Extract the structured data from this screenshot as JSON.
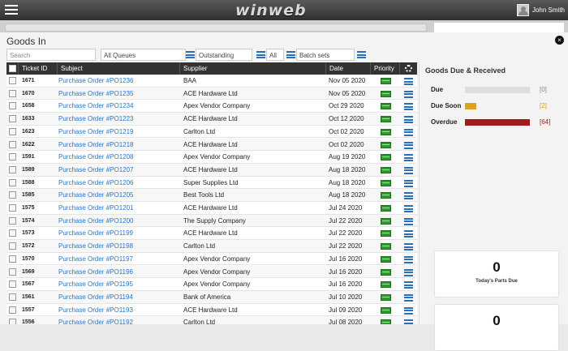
{
  "app": {
    "logo": "winweb",
    "user_name": "John Smith"
  },
  "modal": {
    "title": "Goods In",
    "close": "×"
  },
  "filters": {
    "search_placeholder": "Search",
    "queue": "All Queues",
    "status": "Outstanding",
    "scope": "All",
    "batch": "Batch sets"
  },
  "columns": [
    "Ticket ID",
    "Subject",
    "Supplier",
    "Date",
    "Priority"
  ],
  "rows": [
    {
      "id": "1671",
      "subject": "Purchase Order #PO1236",
      "supplier": "BAA",
      "date": "Nov 05 2020"
    },
    {
      "id": "1670",
      "subject": "Purchase Order #PO1235",
      "supplier": "ACE Hardware Ltd",
      "date": "Nov 05 2020"
    },
    {
      "id": "1658",
      "subject": "Purchase Order #PO1234",
      "supplier": "Apex Vendor Company",
      "date": "Oct 29 2020"
    },
    {
      "id": "1633",
      "subject": "Purchase Order #PO1223",
      "supplier": "ACE Hardware Ltd",
      "date": "Oct 12 2020"
    },
    {
      "id": "1623",
      "subject": "Purchase Order #PO1219",
      "supplier": "Carlton Ltd",
      "date": "Oct 02 2020"
    },
    {
      "id": "1622",
      "subject": "Purchase Order #PO1218",
      "supplier": "ACE Hardware Ltd",
      "date": "Oct 02 2020"
    },
    {
      "id": "1591",
      "subject": "Purchase Order #PO1208",
      "supplier": "Apex Vendor Company",
      "date": "Aug 19 2020"
    },
    {
      "id": "1589",
      "subject": "Purchase Order #PO1207",
      "supplier": "ACE Hardware Ltd",
      "date": "Aug 18 2020"
    },
    {
      "id": "1588",
      "subject": "Purchase Order #PO1206",
      "supplier": "Super Supplies Ltd",
      "date": "Aug 18 2020"
    },
    {
      "id": "1585",
      "subject": "Purchase Order #PO1205",
      "supplier": "Best Tools Ltd",
      "date": "Aug 18 2020"
    },
    {
      "id": "1575",
      "subject": "Purchase Order #PO1201",
      "supplier": "ACE Hardware Ltd",
      "date": "Jul 24 2020"
    },
    {
      "id": "1574",
      "subject": "Purchase Order #PO1200",
      "supplier": "The Supply Company",
      "date": "Jul 22 2020"
    },
    {
      "id": "1573",
      "subject": "Purchase Order #PO1199",
      "supplier": "ACE Hardware Ltd",
      "date": "Jul 22 2020"
    },
    {
      "id": "1572",
      "subject": "Purchase Order #PO1198",
      "supplier": "Carlton Ltd",
      "date": "Jul 22 2020"
    },
    {
      "id": "1570",
      "subject": "Purchase Order #PO1197",
      "supplier": "Apex Vendor Company",
      "date": "Jul 16 2020"
    },
    {
      "id": "1569",
      "subject": "Purchase Order #PO1196",
      "supplier": "Apex Vendor Company",
      "date": "Jul 16 2020"
    },
    {
      "id": "1567",
      "subject": "Purchase Order #PO1195",
      "supplier": "Apex Vendor Company",
      "date": "Jul 16 2020"
    },
    {
      "id": "1561",
      "subject": "Purchase Order #PO1194",
      "supplier": "Bank of America",
      "date": "Jul 10 2020"
    },
    {
      "id": "1557",
      "subject": "Purchase Order #PO1193",
      "supplier": "ACE Hardware Ltd",
      "date": "Jul 09 2020"
    },
    {
      "id": "1556",
      "subject": "Purchase Order #PO1192",
      "supplier": "Carlton Ltd",
      "date": "Jul 08 2020"
    }
  ],
  "side": {
    "title": "Goods Due & Received",
    "stats": [
      {
        "label": "Due",
        "count": "[0]",
        "color": "#888888",
        "fill_pct": 0
      },
      {
        "label": "Due Soon",
        "count": "[2]",
        "color": "#e0a020",
        "fill_pct": 15
      },
      {
        "label": "Overdue",
        "count": "[64]",
        "color": "#a01c1c",
        "fill_pct": 100
      }
    ],
    "tiles": [
      {
        "value": "0",
        "label": "Today's Parts Due"
      },
      {
        "value": "0",
        "label": ""
      }
    ]
  },
  "colors": {
    "accent": "#2a74c5",
    "header": "#333333",
    "priority": "#2c9a2c"
  }
}
